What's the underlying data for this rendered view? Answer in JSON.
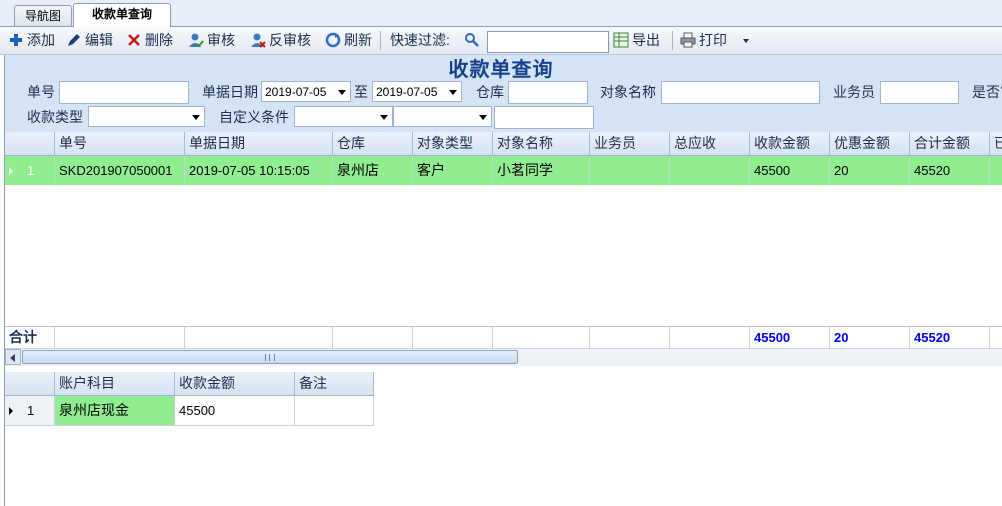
{
  "tabs": [
    {
      "label": "导航图",
      "active": false
    },
    {
      "label": "收款单查询",
      "active": true
    }
  ],
  "toolbar": {
    "add": "添加",
    "edit": "编辑",
    "delete": "删除",
    "audit": "审核",
    "unaudit": "反审核",
    "refresh": "刷新",
    "quick_filter_label": "快速过滤:",
    "quick_filter_value": "",
    "export": "导出",
    "print": "打印"
  },
  "query": {
    "title": "收款单查询",
    "order_no_label": "单号",
    "order_no_value": "",
    "date_label": "单据日期",
    "date_from": "2019-07-05",
    "to_label": "至",
    "date_to": "2019-07-05",
    "warehouse_label": "仓库",
    "warehouse_value": "",
    "target_name_label": "对象名称",
    "target_name_value": "",
    "salesman_label": "业务员",
    "salesman_value": "",
    "audited_label": "是否审",
    "receipt_type_label": "收款类型",
    "receipt_type_value": "",
    "custom_cond_label": "自定义条件",
    "custom_field": "",
    "custom_op": "",
    "custom_value": ""
  },
  "main_grid": {
    "columns": [
      "单号",
      "单据日期",
      "仓库",
      "对象类型",
      "对象名称",
      "业务员",
      "总应收",
      "收款金额",
      "优惠金额",
      "合计金额",
      "已"
    ],
    "rows": [
      {
        "index": "1",
        "cells": [
          "SKD201907050001",
          "2019-07-05 10:15:05",
          "泉州店",
          "客户",
          "小茗同学",
          "",
          "",
          "45500",
          "20",
          "45520",
          ""
        ]
      }
    ],
    "summary_label": "合计",
    "summary": [
      "",
      "",
      "",
      "",
      "",
      "",
      "",
      "45500",
      "20",
      "45520",
      ""
    ]
  },
  "detail_grid": {
    "columns": [
      "账户科目",
      "收款金额",
      "备注"
    ],
    "rows": [
      {
        "index": "1",
        "cells": [
          "泉州店现金",
          "45500",
          ""
        ]
      }
    ]
  },
  "colors": {
    "row_highlight": "#90ee90",
    "title": "#15428b",
    "summary_text": "#0000ff",
    "panel_bg": "#d5e4f5"
  }
}
